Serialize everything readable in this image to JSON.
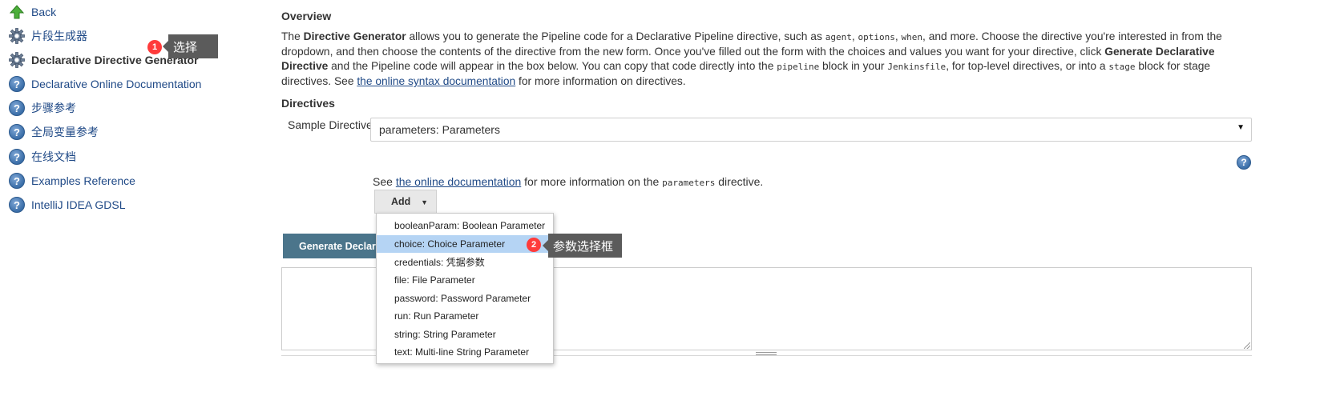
{
  "sidebar": {
    "items": [
      {
        "label": "Back",
        "icon": "up-arrow-icon"
      },
      {
        "label": "片段生成器",
        "icon": "gear-icon"
      },
      {
        "label": "Declarative Directive Generator",
        "icon": "gear-icon"
      },
      {
        "label": "Declarative Online Documentation",
        "icon": "help-icon"
      },
      {
        "label": "步骤参考",
        "icon": "help-icon"
      },
      {
        "label": "全局变量参考",
        "icon": "help-icon"
      },
      {
        "label": "在线文档",
        "icon": "help-icon"
      },
      {
        "label": "Examples Reference",
        "icon": "help-icon"
      },
      {
        "label": "IntelliJ IDEA GDSL",
        "icon": "help-icon"
      }
    ]
  },
  "callouts": [
    {
      "number": "1",
      "text": "选择"
    },
    {
      "number": "2",
      "text": "参数选择框"
    }
  ],
  "overview": {
    "title": "Overview",
    "p1": "The ",
    "b1": "Directive Generator",
    "p2": " allows you to generate the Pipeline code for a Declarative Pipeline directive, such as ",
    "c1": "agent",
    "p3": ", ",
    "c2": "options",
    "p4": ", ",
    "c3": "when",
    "p5": ", and more. Choose the directive you're interested in from the dropdown, and then choose the contents of the directive from the new form. Once you've filled out the form with the choices and values you want for your directive, click ",
    "b2": "Generate Declarative Directive",
    "p6": " and the Pipeline code will appear in the box below. You can copy that code directly into the ",
    "c4": "pipeline",
    "p7": " block in your ",
    "c5": "Jenkinsfile",
    "p8": ", for top-level directives, or into a ",
    "c6": "stage",
    "p9": " block for stage directives. See ",
    "link": "the online syntax documentation",
    "p10": " for more information on directives."
  },
  "directives": {
    "title": "Directives",
    "sample_label": "Sample Directive",
    "selected": "parameters: Parameters",
    "doc_prefix": "See ",
    "doc_link": "the online documentation",
    "doc_mid": " for more information on the ",
    "doc_code": "parameters",
    "doc_suffix": " directive.",
    "add_label": "Add",
    "generate_label": "Generate Declarative Directive"
  },
  "menu": {
    "items": [
      "booleanParam: Boolean Parameter",
      "choice: Choice Parameter",
      "credentials: 凭据参数",
      "file: File Parameter",
      "password: Password Parameter",
      "run: Run Parameter",
      "string: String Parameter",
      "text: Multi-line String Parameter"
    ],
    "highlighted_index": 1
  },
  "colors": {
    "link": "#204a87",
    "generate_button": "#4b758b",
    "highlight": "#b5d4f4",
    "badge": "#ff3b3b",
    "callout": "#5b5b5b"
  }
}
